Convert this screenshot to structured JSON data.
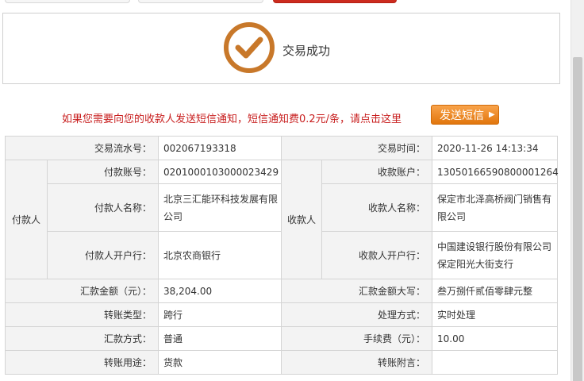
{
  "success": {
    "text": "交易成功",
    "icon": "checkmark-circle-icon"
  },
  "sms": {
    "notice": "如果您需要向您的收款人发送短信通知，短信通知费0.2元/条，请点击这里",
    "button_label": "发送短信",
    "button_arrow": "▶"
  },
  "groups": {
    "payer": "付款人",
    "payee": "收款人"
  },
  "rows": {
    "txn_no_label": "交易流水号：",
    "txn_no": "002067193318",
    "txn_time_label": "交易时间：",
    "txn_time": "2020-11-26 14:13:34",
    "payer_acct_label": "付款账号：",
    "payer_acct": "0201000103000023429",
    "payee_acct_label": "收款账户：",
    "payee_acct": "13050166590800001264",
    "payer_name_label": "付款人名称：",
    "payer_name": "北京三汇能环科技发展有限公司",
    "payee_name_label": "收款人名称：",
    "payee_name": "保定市北泽高桥阀门销售有限公司",
    "payer_bank_label": "付款人开户行：",
    "payer_bank": "北京农商银行",
    "payee_bank_label": "收款人开户行：",
    "payee_bank": "中国建设银行股份有限公司保定阳光大街支行",
    "amount_label": "汇款金额（元）：",
    "amount": "38,204.00",
    "amount_upper_label": "汇款金额大写：",
    "amount_upper": "叁万捌仟贰佰零肆元整",
    "transfer_type_label": "转账类型：",
    "transfer_type": "跨行",
    "process_label": "处理方式：",
    "process": "实时处理",
    "remit_mode_label": "汇款方式：",
    "remit_mode": "普通",
    "fee_label": "手续费（元）：",
    "fee": "10.00",
    "purpose_label": "转账用途：",
    "purpose": "货款",
    "remark_label": "转账附言：",
    "remark": ""
  },
  "colors": {
    "accent_red": "#c81e1e",
    "button_orange": "#f08a24",
    "check_brown": "#c8782a"
  }
}
